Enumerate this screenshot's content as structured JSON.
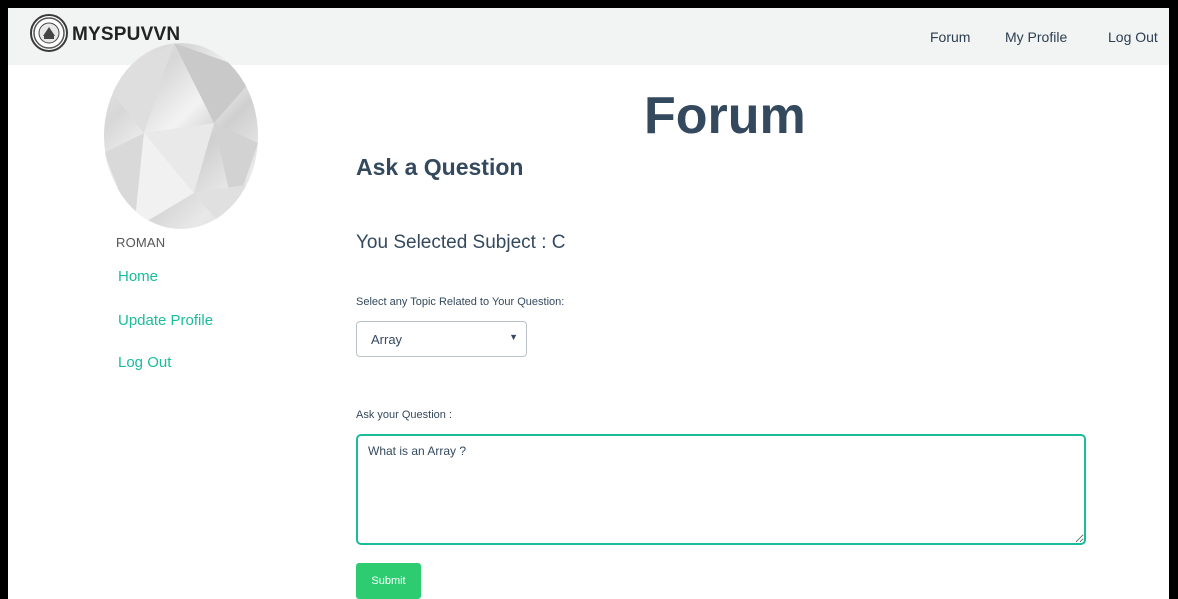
{
  "brand": {
    "name": "MYSPUVVN",
    "logo_icon": "university-seal-icon"
  },
  "nav": {
    "links": [
      "Forum",
      "My Profile",
      "Log Out"
    ]
  },
  "sidebar": {
    "username": "ROMAN",
    "links": [
      "Home",
      "Update Profile",
      "Log Out"
    ],
    "link_color": "#1abc9c"
  },
  "main": {
    "title": "Forum",
    "section_title": "Ask a Question",
    "subject_line": "You Selected Subject : C",
    "topic_label": "Select any Topic Related to Your Question:",
    "topic_selected": "Array",
    "question_label": "Ask your Question :",
    "question_value": "What is an Array ?",
    "submit_label": "Submit"
  },
  "colors": {
    "heading": "#34495e",
    "accent": "#1abc9c",
    "submit": "#2ecc71",
    "navbar_bg": "#f2f3f3"
  }
}
